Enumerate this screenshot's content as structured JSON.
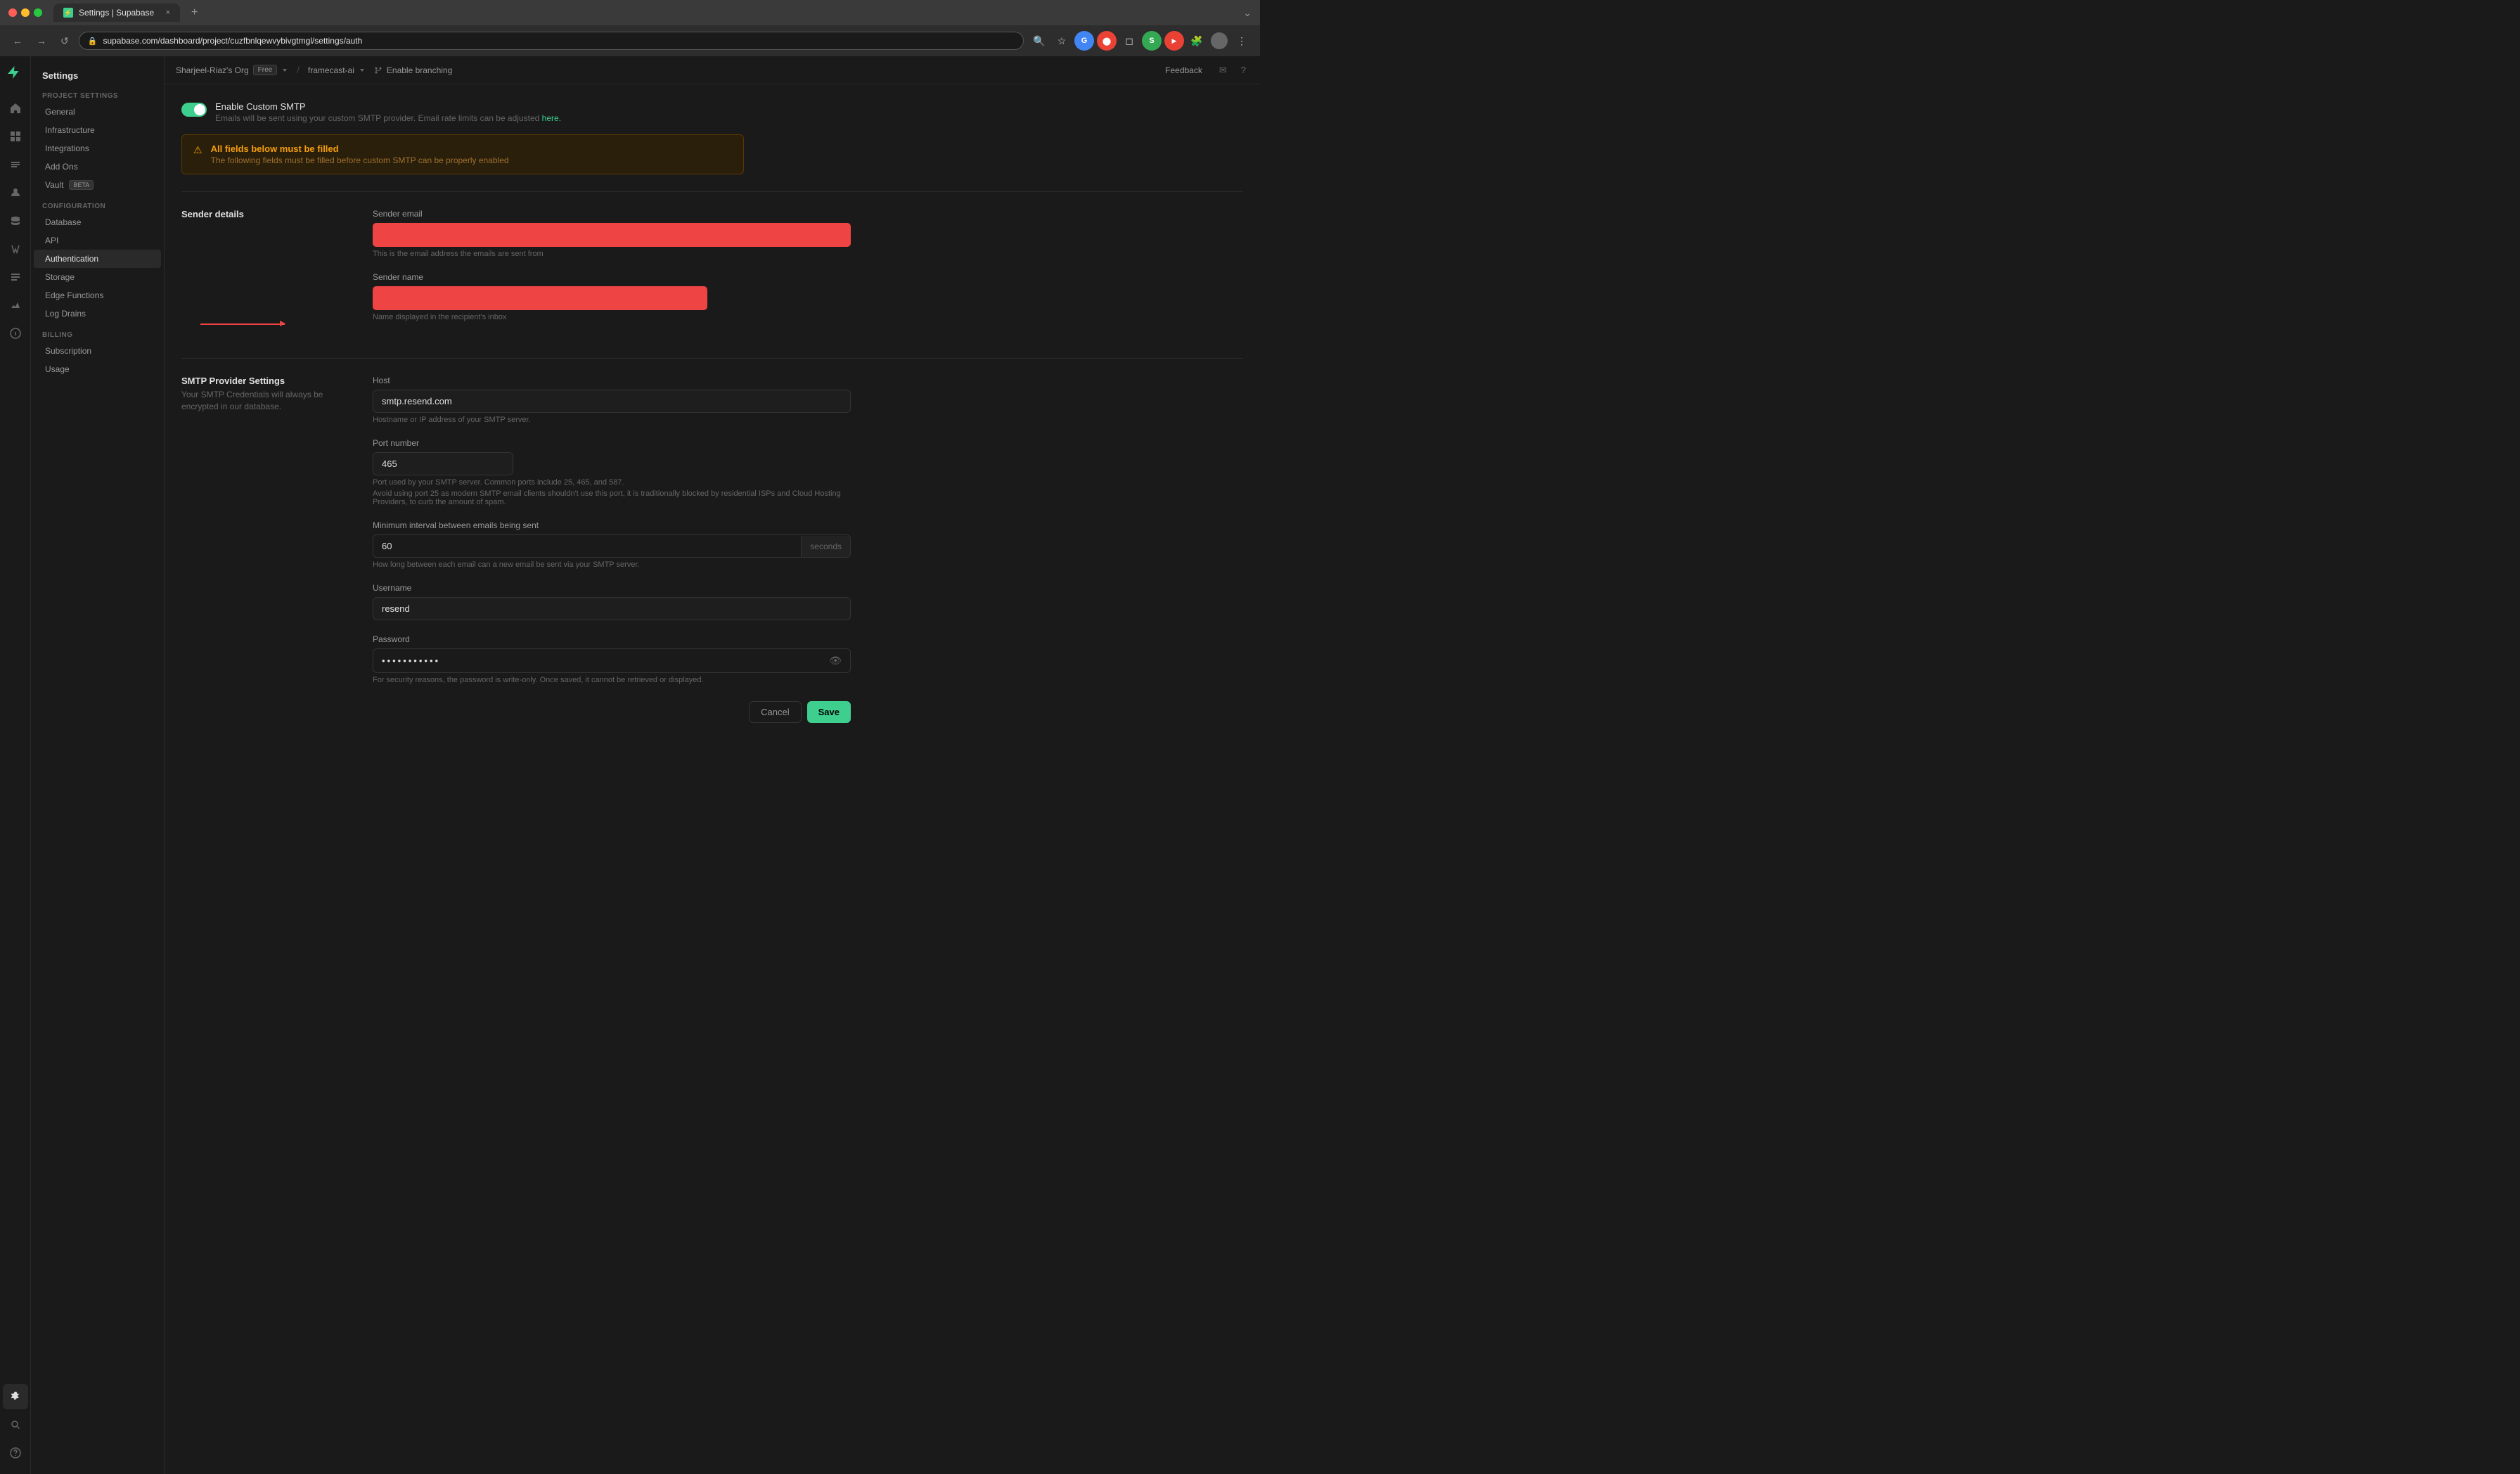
{
  "browser": {
    "tab_title": "Settings | Supabase",
    "url": "supabase.com/dashboard/project/cuzfbnlqewvybivgtmgl/settings/auth",
    "favicon_color": "#3ecf8e"
  },
  "header": {
    "org_name": "Sharjeel-Riaz's Org",
    "plan_badge": "Free",
    "project_name": "framecast-ai",
    "branch_label": "Enable branching",
    "feedback_label": "Feedback"
  },
  "sidebar": {
    "title": "Settings",
    "project_settings_label": "PROJECT SETTINGS",
    "items_project": [
      {
        "label": "General",
        "active": false
      },
      {
        "label": "Infrastructure",
        "active": false
      },
      {
        "label": "Integrations",
        "active": false
      },
      {
        "label": "Add Ons",
        "active": false
      },
      {
        "label": "Vault",
        "active": false,
        "badge": "BETA"
      }
    ],
    "configuration_label": "CONFIGURATION",
    "items_config": [
      {
        "label": "Database",
        "active": false
      },
      {
        "label": "API",
        "active": false
      },
      {
        "label": "Authentication",
        "active": true
      },
      {
        "label": "Storage",
        "active": false
      },
      {
        "label": "Edge Functions",
        "active": false
      },
      {
        "label": "Log Drains",
        "active": false
      }
    ],
    "billing_label": "BILLING",
    "items_billing": [
      {
        "label": "Subscription",
        "active": false
      },
      {
        "label": "Usage",
        "active": false
      }
    ]
  },
  "smtp": {
    "toggle_label": "Enable Custom SMTP",
    "toggle_sublabel": "Emails will be sent using your custom SMTP provider. Email rate limits can be adjusted",
    "toggle_link": "here.",
    "toggle_enabled": true,
    "warning_title": "All fields below must be filled",
    "warning_desc": "The following fields must be filled before custom SMTP can be properly enabled",
    "sender_details_label": "Sender details",
    "sender_email_label": "Sender email",
    "sender_email_hint": "This is the email address the emails are sent from",
    "sender_name_label": "Sender name",
    "sender_name_hint": "Name displayed in the recipient's inbox",
    "smtp_provider_label": "SMTP Provider Settings",
    "smtp_provider_desc": "Your SMTP Credentials will always be encrypted in our database.",
    "host_label": "Host",
    "host_value": "smtp.resend.com",
    "host_hint": "Hostname or IP address of your SMTP server.",
    "port_label": "Port number",
    "port_value": "465",
    "port_hint1": "Port used by your SMTP server. Common ports include 25, 465, and 587.",
    "port_hint2": "Avoid using port 25 as modern SMTP email clients shouldn't use this port, it is traditionally blocked by residential ISPs and Cloud Hosting Providers, to curb the amount of spam.",
    "min_interval_label": "Minimum interval between emails being sent",
    "min_interval_value": "60",
    "min_interval_suffix": "seconds",
    "min_interval_hint": "How long between each email can a new email be sent via your SMTP server.",
    "username_label": "Username",
    "username_value": "resend",
    "password_label": "Password",
    "password_value": "••••••••",
    "password_hint": "For security reasons, the password is write-only. Once saved, it cannot be retrieved or displayed.",
    "cancel_label": "Cancel",
    "save_label": "Save"
  },
  "icons": {
    "back": "←",
    "forward": "→",
    "refresh": "↺",
    "lock": "🔒",
    "star": "☆",
    "more": "⋮",
    "expand": "⌄",
    "tab_close": "×",
    "new_tab": "+",
    "eye": "👁",
    "warning": "⚠",
    "branch": "⎇",
    "home": "⌂",
    "table": "▦",
    "shield": "⚓",
    "users": "👤",
    "storage": "🗄",
    "logs": "📋",
    "settings": "⚙",
    "search": "🔍",
    "help": "?",
    "gear": "⚙",
    "bolt": "⚡"
  }
}
